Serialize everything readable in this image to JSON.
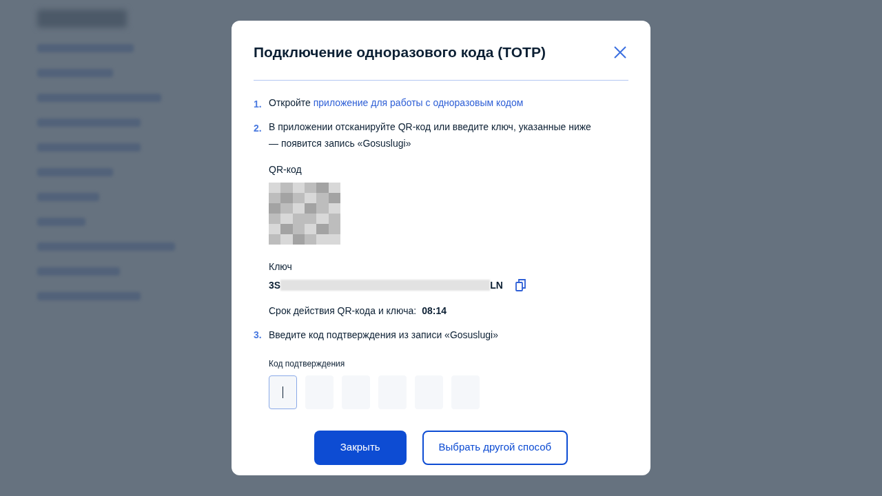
{
  "dialog": {
    "title": "Подключение одноразового кода (TOTP)",
    "steps": [
      {
        "number": "1.",
        "text": "Откройте ",
        "link": "приложение для работы с одноразовым кодом"
      },
      {
        "number": "2.",
        "text": "В приложении отсканируйте QR-код или введите ключ, указанные ниже — появится запись «Gosuslugi»"
      }
    ],
    "qr_label": "QR-код",
    "key_label": "Ключ",
    "key_start": "3S",
    "key_end": "LN",
    "expiry_label": "Срок действия QR-кода и ключа:",
    "expiry_time": "08:14",
    "step3": {
      "number": "3.",
      "text": "Введите код подтверждения из записи «Gosuslugi»"
    },
    "code_label": "Код подтверждения",
    "code_cells": [
      {
        "focused": true
      },
      {
        "focused": false
      },
      {
        "focused": false
      },
      {
        "focused": false
      },
      {
        "focused": false
      },
      {
        "focused": false
      }
    ],
    "buttons": [
      {
        "label": "Закрыть",
        "kind": "primary"
      },
      {
        "label": "Выбрать другой способ",
        "kind": "secondary"
      }
    ]
  }
}
